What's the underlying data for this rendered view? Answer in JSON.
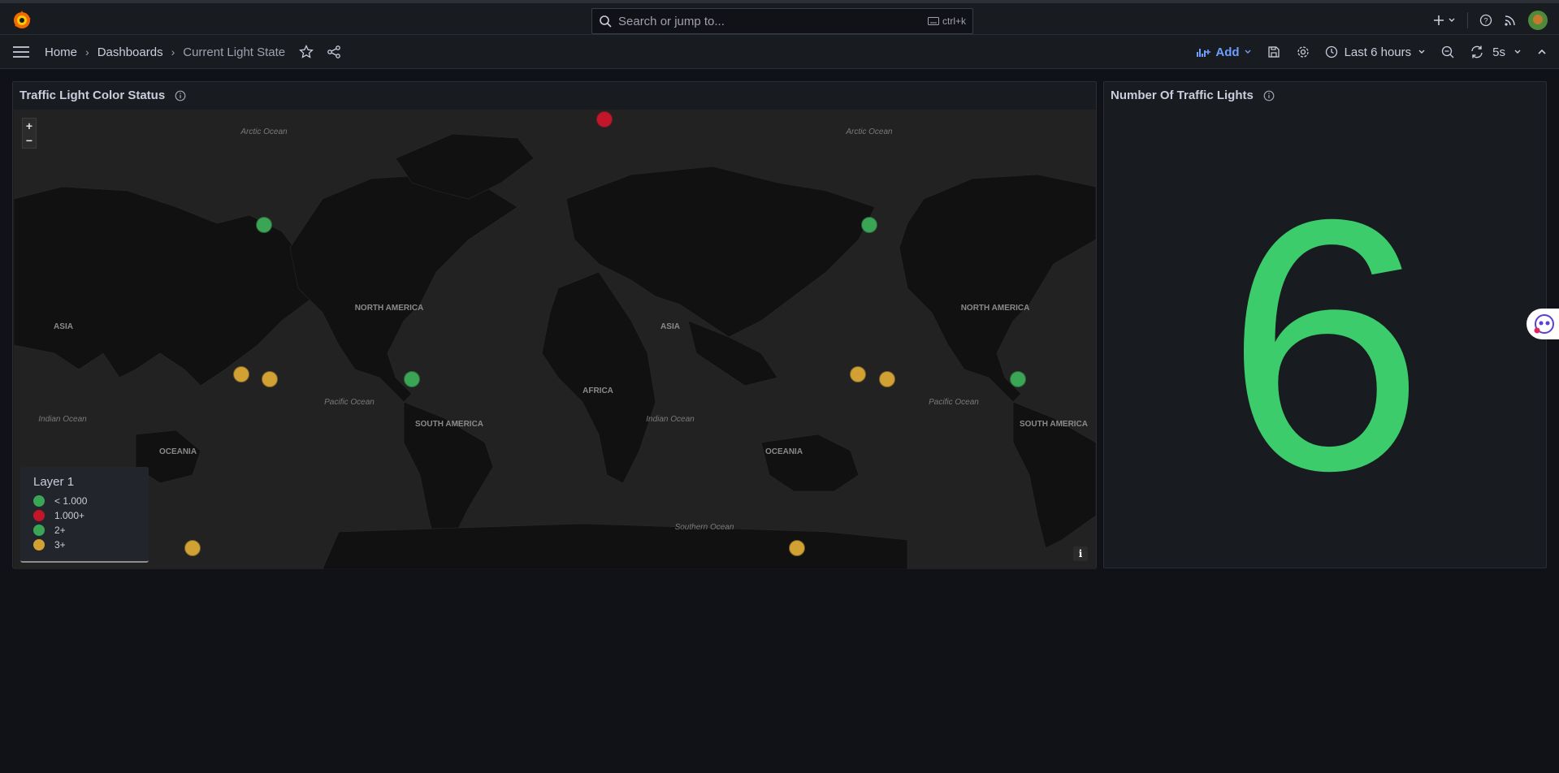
{
  "topbar": {
    "search_placeholder": "Search or jump to...",
    "search_shortcut": "ctrl+k",
    "icons": [
      "grafana-logo-icon",
      "search-icon",
      "keyboard-icon",
      "plus-icon",
      "help-icon",
      "rss-icon",
      "user-avatar"
    ]
  },
  "navbar": {
    "breadcrumbs": [
      "Home",
      "Dashboards",
      "Current Light State"
    ],
    "add_label": "Add",
    "time_range": "Last 6 hours",
    "refresh_interval": "5s"
  },
  "panels": {
    "map": {
      "title": "Traffic Light Color Status",
      "zoom_in": "+",
      "zoom_out": "−",
      "info": "i",
      "map_labels": [
        "Arctic Ocean",
        "NORTH AMERICA",
        "ASIA",
        "AFRICA",
        "SOUTH AMERICA",
        "OCEANIA",
        "Indian Ocean",
        "Pacific Ocean",
        "Southern Ocean"
      ],
      "legend": {
        "title": "Layer 1",
        "items": [
          {
            "label": "< 1.000",
            "color": "#3aa655"
          },
          {
            "label": "1.000+",
            "color": "#c4162a"
          },
          {
            "label": "2+",
            "color": "#3aa655"
          },
          {
            "label": "3+",
            "color": "#d1a133"
          }
        ]
      },
      "markers": [
        {
          "color": "#c4162a"
        },
        {
          "color": "#3aa655"
        },
        {
          "color": "#3aa655"
        },
        {
          "color": "#d1a133"
        },
        {
          "color": "#d1a133"
        },
        {
          "color": "#3aa655"
        },
        {
          "color": "#d1a133"
        },
        {
          "color": "#d1a133"
        },
        {
          "color": "#3aa655"
        },
        {
          "color": "#d1a133"
        },
        {
          "color": "#d1a133"
        }
      ]
    },
    "stat": {
      "title": "Number Of Traffic Lights",
      "value": "6",
      "color": "#3dcc6b"
    }
  }
}
